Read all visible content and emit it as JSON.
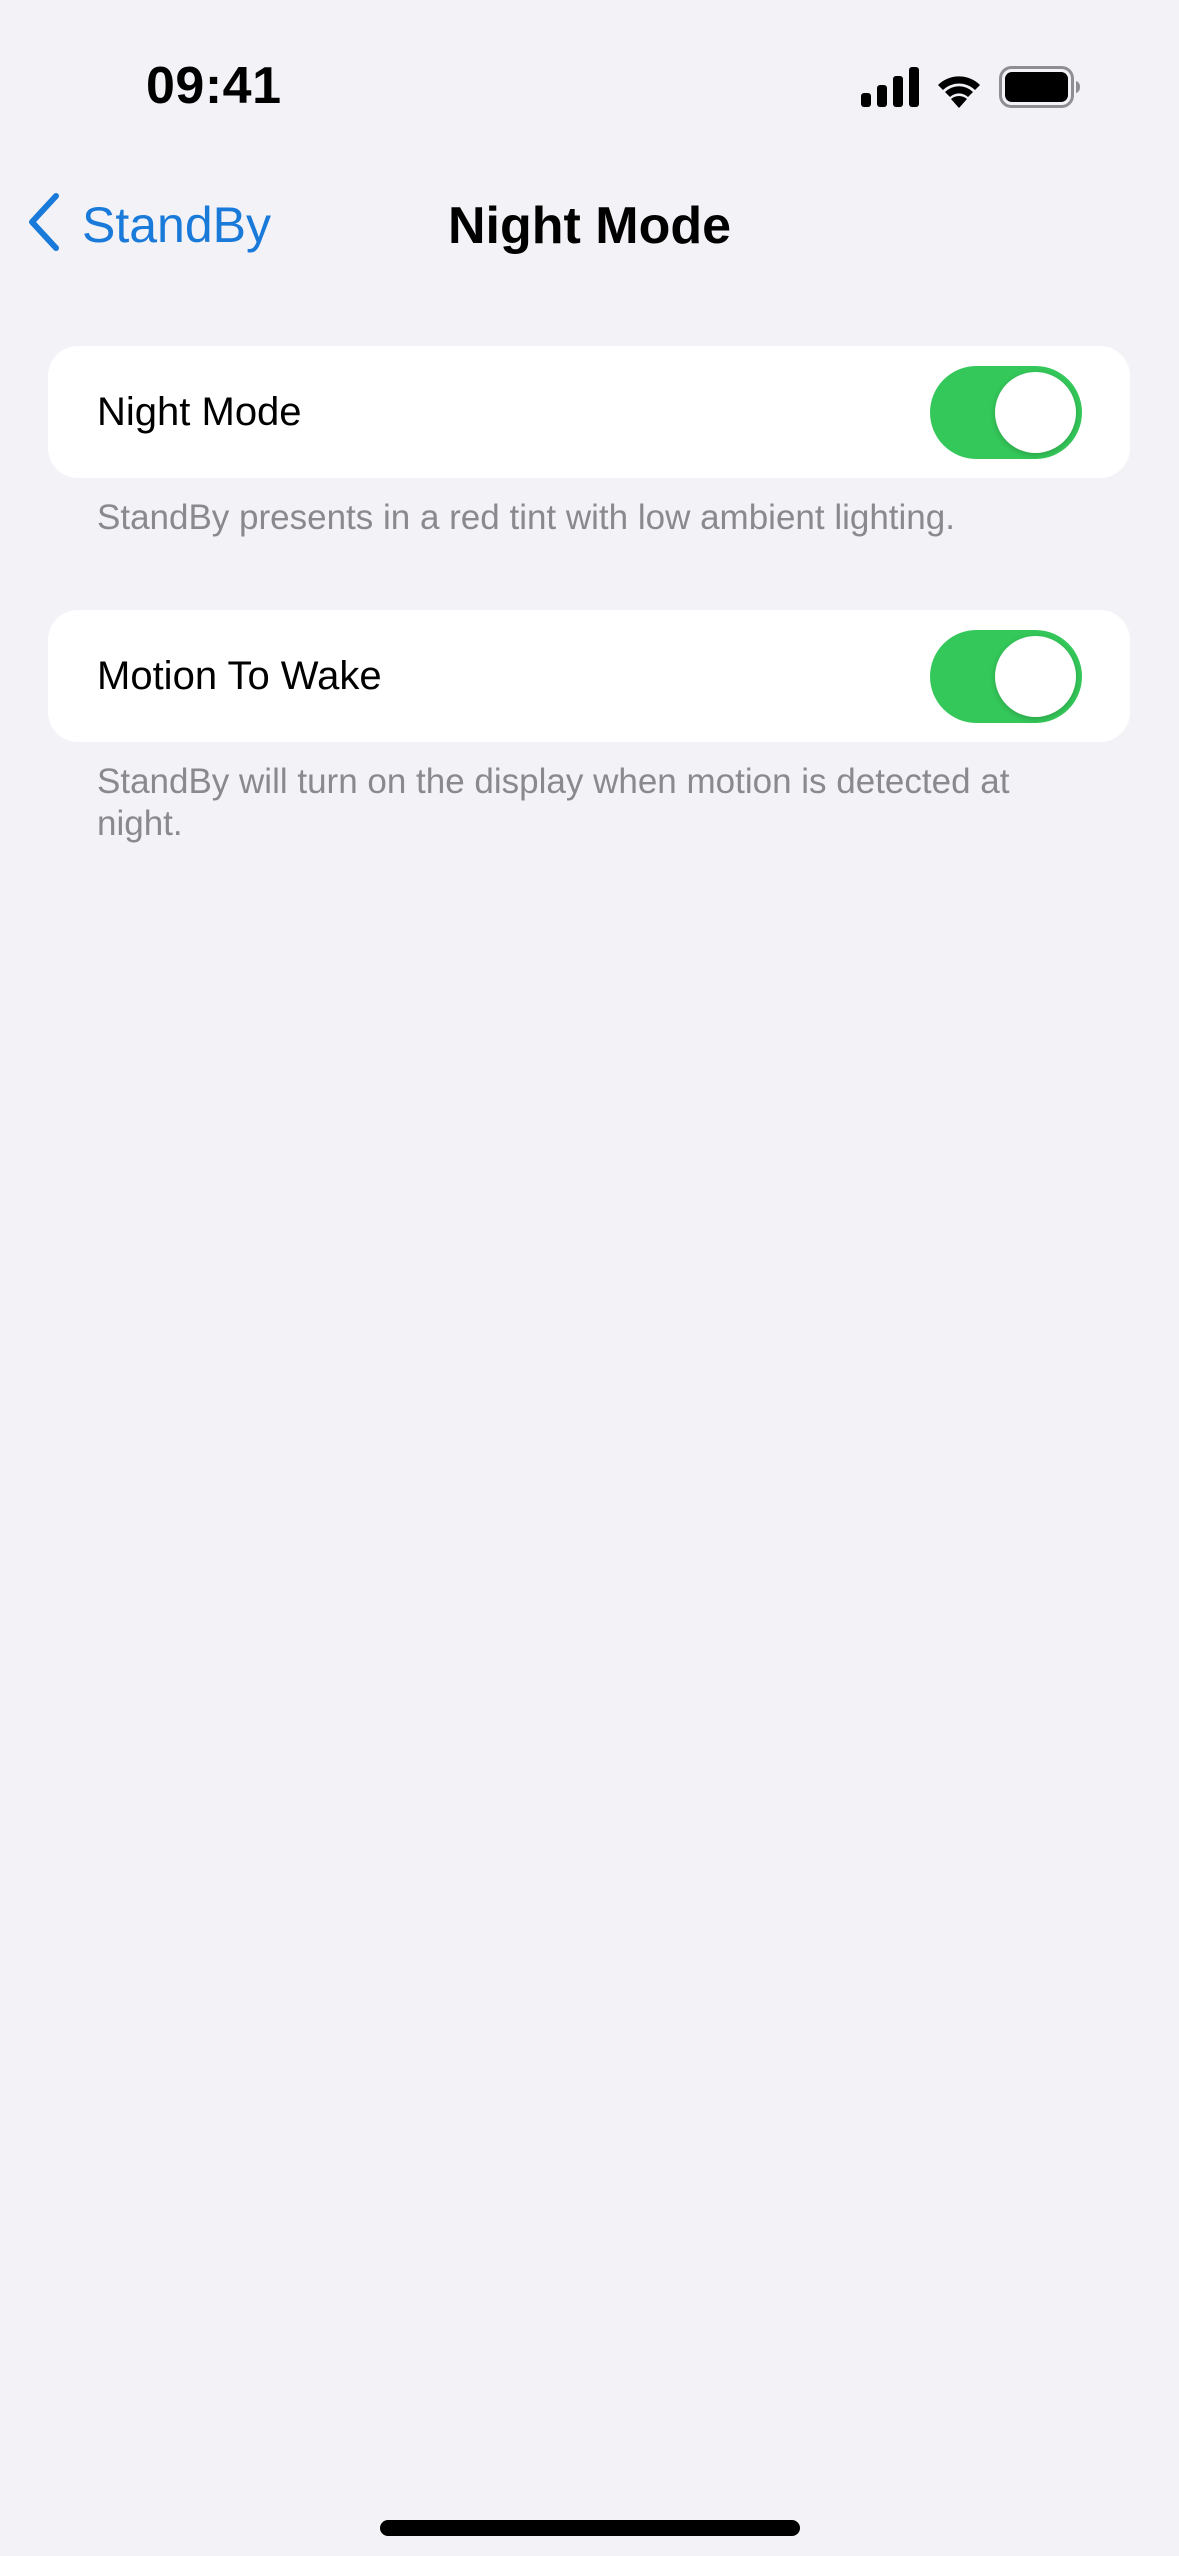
{
  "status_bar": {
    "time": "09:41",
    "icons": [
      "cellular-signal-icon",
      "wifi-icon",
      "battery-icon"
    ]
  },
  "nav": {
    "back_label": "StandBy",
    "back_icon": "chevron-left-icon",
    "title": "Night Mode"
  },
  "settings": [
    {
      "label": "Night Mode",
      "enabled": true,
      "footer": "StandBy presents in a red tint with low ambient lighting."
    },
    {
      "label": "Motion To Wake",
      "enabled": true,
      "footer": "StandBy will turn on the display when motion is detected at night."
    }
  ],
  "colors": {
    "accent": "#1a7ad9",
    "toggle_on": "#34c759",
    "background": "#f2f2f7",
    "footer_text": "#8a8a8e"
  }
}
